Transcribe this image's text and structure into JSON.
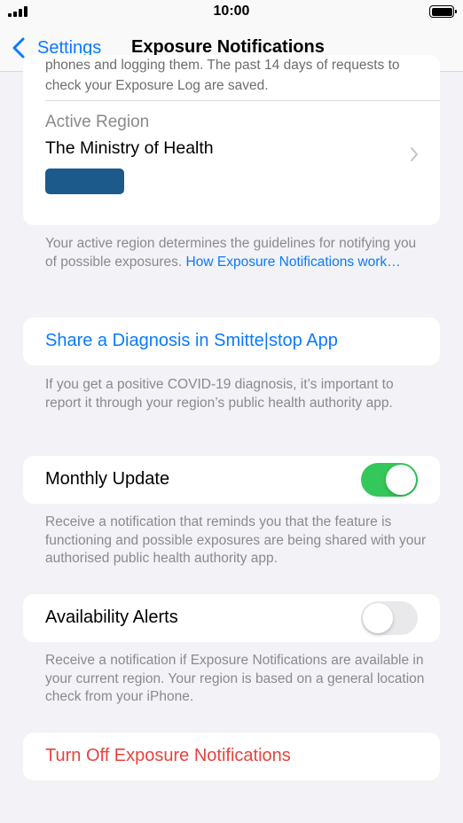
{
  "status": {
    "time": "10:00"
  },
  "nav": {
    "back_label": "Settings",
    "title": "Exposure Notifications"
  },
  "logging": {
    "text": "phones and logging them. The past 14 days of requests to check your Exposure Log are saved."
  },
  "region": {
    "label": "Active Region",
    "name": "The Ministry of Health",
    "footnote": "Your active region determines the guidelines for notifying you of possible exposures. ",
    "footnote_link": "How Exposure Notifications work…"
  },
  "share": {
    "label": "Share a Diagnosis in Smitte|stop App",
    "footnote": "If you get a positive COVID-19 diagnosis, it’s important to report it through your region’s public health authority app."
  },
  "monthly_update": {
    "label": "Monthly Update",
    "enabled": true,
    "footnote": "Receive a notification that reminds you that the feature is functioning and possible exposures are being shared with your authorised public health authority app."
  },
  "availability_alerts": {
    "label": "Availability Alerts",
    "enabled": false,
    "footnote": "Receive a notification if Exposure Notifications are available in your current region. Your region is based on a general location check from your iPhone."
  },
  "turn_off": {
    "label": "Turn Off Exposure Notifications"
  },
  "colors": {
    "accent": "#0a7aff",
    "destructive": "#e8433c",
    "toggle_on": "#34c759"
  }
}
